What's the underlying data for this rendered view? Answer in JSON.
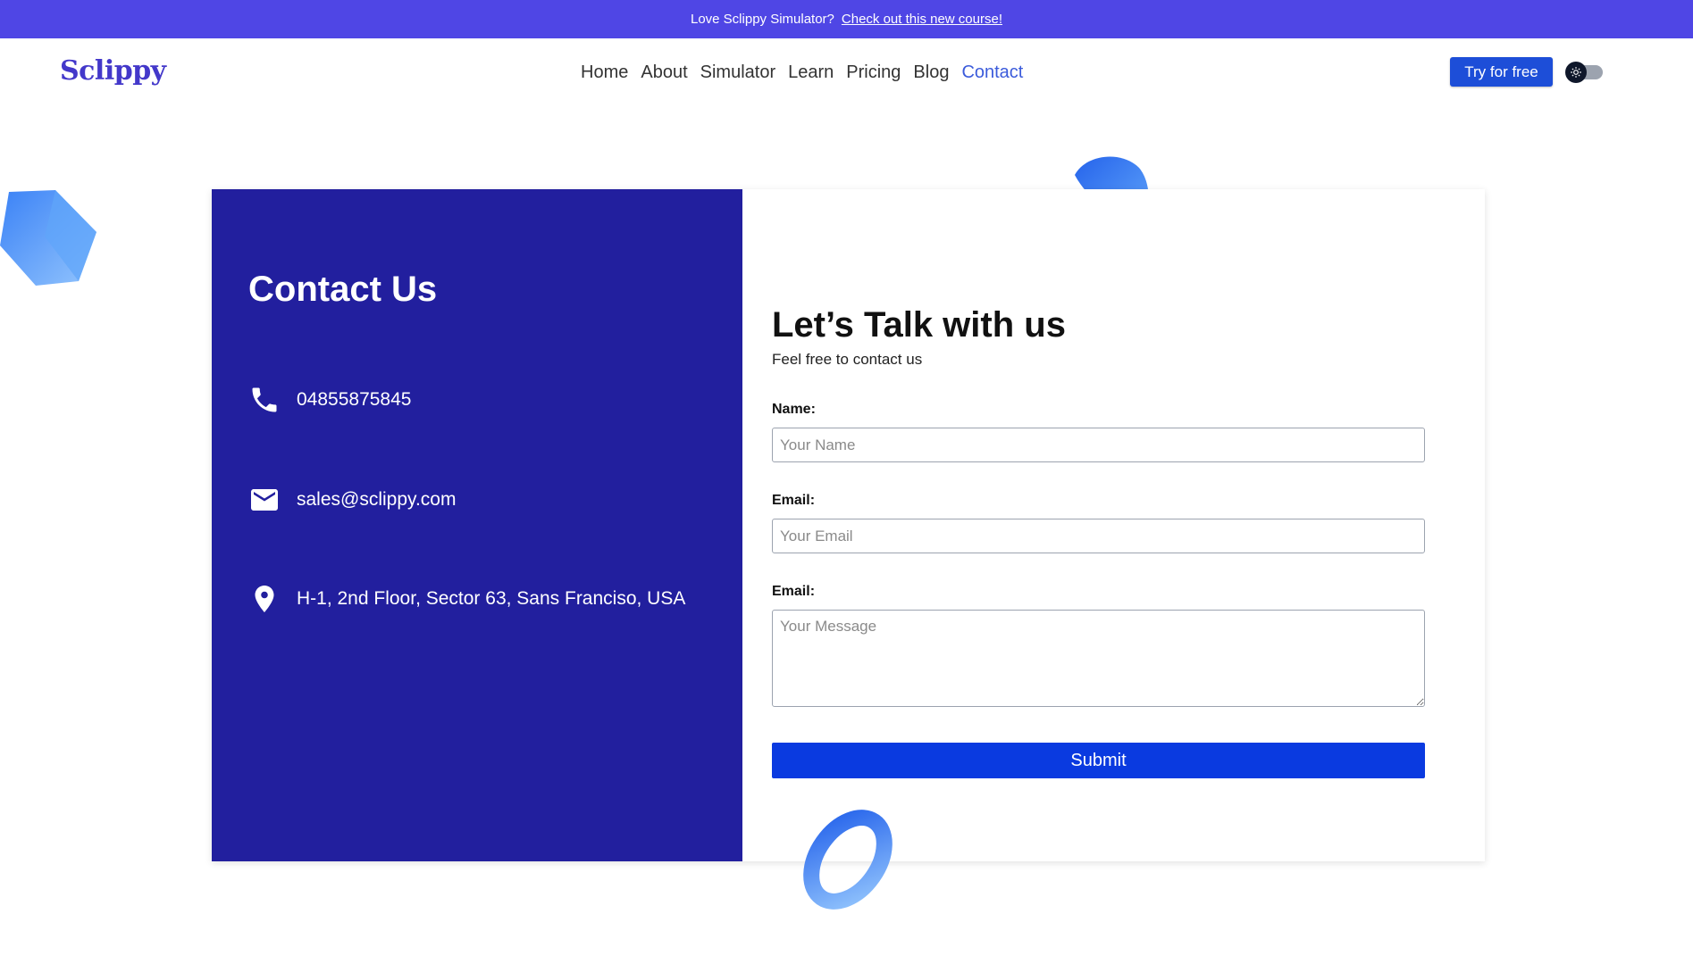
{
  "banner": {
    "text": "Love Sclippy Simulator?",
    "link_text": "Check out this new course!"
  },
  "nav": {
    "logo": "Sclippy",
    "links": [
      "Home",
      "About",
      "Simulator",
      "Learn",
      "Pricing",
      "Blog",
      "Contact"
    ],
    "active": "Contact",
    "cta_label": "Try for free",
    "theme_icon": "sun-icon"
  },
  "contact": {
    "title": "Contact Us",
    "phone": "04855875845",
    "email": "sales@sclippy.com",
    "address": "H-1, 2nd Floor, Sector 63, Sans Franciso, USA",
    "icons": [
      "phone-icon",
      "mail-icon",
      "location-pin-icon"
    ]
  },
  "form": {
    "title": "Let’s Talk with us",
    "subtitle": "Feel free to contact us",
    "name_label": "Name:",
    "name_placeholder": "Your Name",
    "email_label": "Email:",
    "email_placeholder": "Your Email",
    "message_label": "Email:",
    "message_placeholder": "Your Message",
    "submit_label": "Submit"
  },
  "colors": {
    "banner": "#4f46e5",
    "panel": "#221f9e",
    "primary_button": "#0a3ae0",
    "accent_link": "#3b5bdb"
  }
}
